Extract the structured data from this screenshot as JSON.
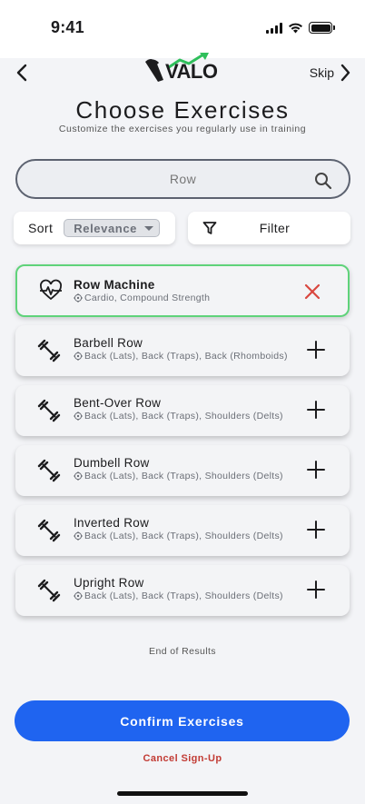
{
  "status_bar": {
    "time": "9:41",
    "icons": [
      "signal-icon",
      "wifi-icon",
      "battery-icon"
    ]
  },
  "header": {
    "back_icon": "chevron-left-icon",
    "logo_text": "VALO",
    "skip_label": "Skip",
    "skip_icon": "chevron-right-icon",
    "title": "Choose Exercises",
    "subtitle": "Customize the exercises you regularly use in training"
  },
  "search": {
    "value": "Row",
    "icon": "search-icon"
  },
  "sort": {
    "label": "Sort",
    "selected": "Relevance",
    "icon": "chevron-down-icon"
  },
  "filter": {
    "label": "Filter",
    "icon": "filter-icon"
  },
  "exercises": [
    {
      "name": "Row Machine",
      "muscles": "Cardio, Compound Strength",
      "icon": "heart-rate-icon",
      "selected": true,
      "action_icon": "remove-icon"
    },
    {
      "name": "Barbell Row",
      "muscles": "Back (Lats), Back (Traps), Back (Rhomboids)",
      "icon": "dumbbell-icon",
      "selected": false,
      "action_icon": "add-icon"
    },
    {
      "name": "Bent-Over Row",
      "muscles": "Back (Lats), Back (Traps), Shoulders (Delts)",
      "icon": "dumbbell-icon",
      "selected": false,
      "action_icon": "add-icon"
    },
    {
      "name": "Dumbell Row",
      "muscles": "Back (Lats), Back (Traps), Shoulders (Delts)",
      "icon": "dumbbell-icon",
      "selected": false,
      "action_icon": "add-icon"
    },
    {
      "name": "Inverted Row",
      "muscles": "Back (Lats), Back (Traps), Shoulders (Delts)",
      "icon": "dumbbell-icon",
      "selected": false,
      "action_icon": "add-icon"
    },
    {
      "name": "Upright Row",
      "muscles": "Back (Lats), Back (Traps), Shoulders (Delts)",
      "icon": "dumbbell-icon",
      "selected": false,
      "action_icon": "add-icon"
    }
  ],
  "footer": {
    "end_text": "End of Results",
    "confirm_label": "Confirm Exercises",
    "cancel_label": "Cancel Sign-Up"
  },
  "colors": {
    "accent": "#1f64f0",
    "selected_border": "#5fd37a",
    "remove": "#d9473f",
    "cancel": "#c23b34",
    "logo_arrow": "#2fbf5b"
  }
}
